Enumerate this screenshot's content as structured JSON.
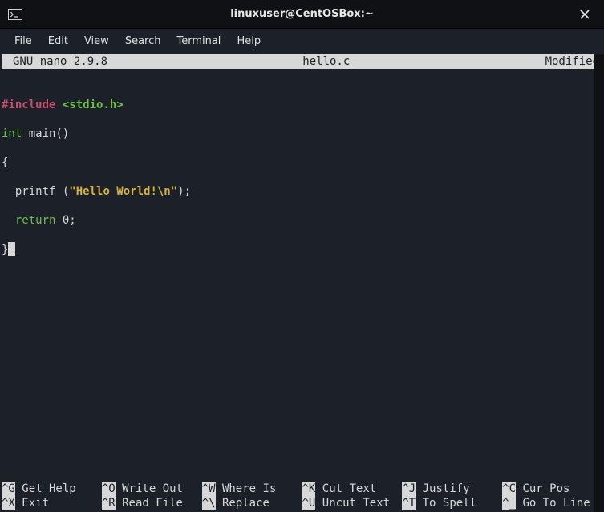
{
  "window": {
    "title": "linuxuser@CentOSBox:~"
  },
  "menu": {
    "items": [
      "File",
      "Edit",
      "View",
      "Search",
      "Terminal",
      "Help"
    ]
  },
  "nano": {
    "version": "GNU nano 2.9.8",
    "filename": "hello.c",
    "status": "Modified"
  },
  "code": {
    "l1": {
      "include": "#include",
      "header": "<stdio.h>"
    },
    "l2": {
      "type": "int",
      "rest": " main()"
    },
    "l3": "{",
    "l4": {
      "pre": "  printf (",
      "str": "\"Hello World!\\n\"",
      "post": ");"
    },
    "l5": {
      "pre": "  ",
      "kw": "return",
      "post": " 0;"
    },
    "l6": "}"
  },
  "shortcuts": [
    {
      "key": "^G",
      "label": " Get Help"
    },
    {
      "key": "^O",
      "label": " Write Out"
    },
    {
      "key": "^W",
      "label": " Where Is"
    },
    {
      "key": "^K",
      "label": " Cut Text"
    },
    {
      "key": "^J",
      "label": " Justify"
    },
    {
      "key": "^C",
      "label": " Cur Pos"
    },
    {
      "key": "^X",
      "label": " Exit"
    },
    {
      "key": "^R",
      "label": " Read File"
    },
    {
      "key": "^\\",
      "label": " Replace"
    },
    {
      "key": "^U",
      "label": " Uncut Text"
    },
    {
      "key": "^T",
      "label": " To Spell"
    },
    {
      "key": "^_",
      "label": " Go To Line"
    }
  ]
}
